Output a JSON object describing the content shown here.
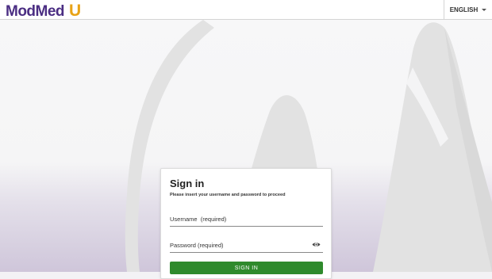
{
  "header": {
    "logo_text": "ModMed",
    "logo_u": "U",
    "language_label": "ENGLISH",
    "language_icon": "caret-down-icon"
  },
  "background": {
    "watermark_icon": "modmed-watermark-logo",
    "colors": {
      "top": "#f7f7f8",
      "bottom": "#cfc6da",
      "shape": "#dcdcdc"
    }
  },
  "signin": {
    "title": "Sign in",
    "subtitle": "Please insert your username and password to proceed",
    "username_placeholder": "Username  (required)",
    "password_placeholder": "Password (required)",
    "show_password_icon": "eye-icon",
    "button_label": "SIGN IN"
  },
  "colors": {
    "brand_purple": "#4b2e83",
    "brand_gold": "#e8a317",
    "button_green": "#2f8a2c"
  }
}
